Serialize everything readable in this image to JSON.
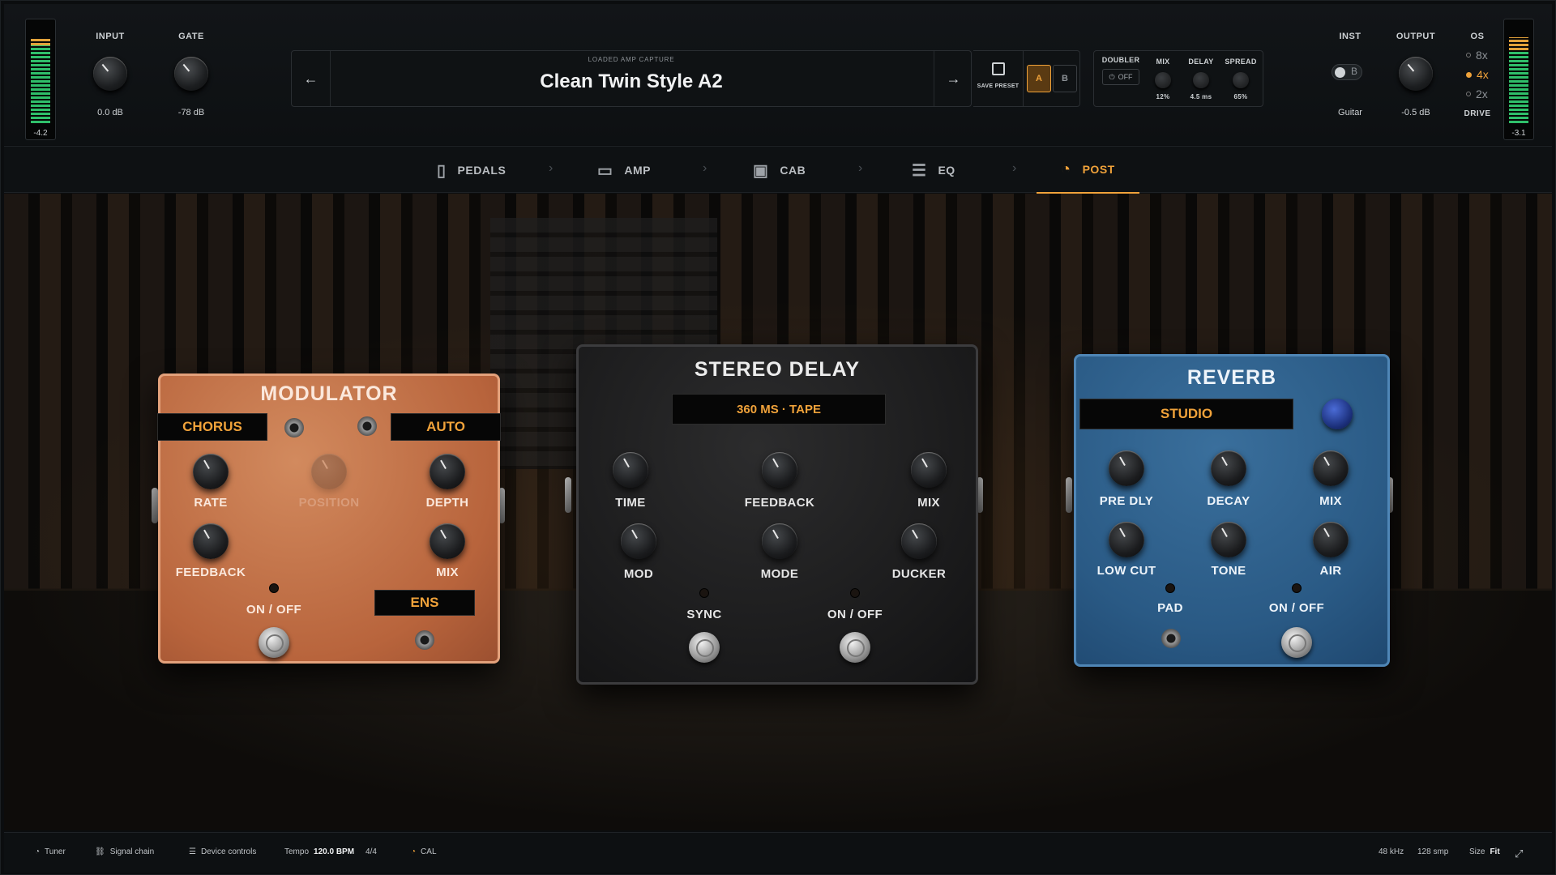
{
  "header": {
    "input_meter": {
      "value": "-4.2",
      "level": 0.82
    },
    "output_meter": {
      "value": "-3.1",
      "level": 0.78
    },
    "input": {
      "label": "INPUT",
      "value": "0.0 dB"
    },
    "gate": {
      "label": "GATE",
      "value": "-78 dB"
    },
    "preset": {
      "caption": "LOADED AMP CAPTURE",
      "name": "Clean Twin Style A2",
      "save_label": "SAVE PRESET",
      "slot_a": "A",
      "slot_b": "B",
      "active_slot": "A"
    },
    "doubler": {
      "label": "DOUBLER",
      "power": "OFF",
      "mix_label": "MIX",
      "mix_value": "12%",
      "delay_label": "DELAY",
      "delay_value": "4.5 ms",
      "spread_label": "SPREAD",
      "spread_value": "65%"
    },
    "inst": {
      "label": "INST",
      "toggle": "B",
      "value": "Guitar"
    },
    "output": {
      "label": "OUTPUT",
      "value": "-0.5 dB"
    },
    "os": {
      "label": "OS",
      "options": [
        "8x",
        "4x",
        "2x"
      ],
      "selected": "4x",
      "drive": "DRIVE"
    }
  },
  "tabs": [
    {
      "label": "PEDALS",
      "icon": "pedal-icon"
    },
    {
      "label": "AMP",
      "icon": "amp-icon"
    },
    {
      "label": "CAB",
      "icon": "cab-icon"
    },
    {
      "label": "EQ",
      "icon": "eq-sliders-icon"
    },
    {
      "label": "POST",
      "icon": "gauge-icon",
      "active": true
    }
  ],
  "modulator": {
    "title": "MODULATOR",
    "mode": "CHORUS",
    "sync": "AUTO",
    "knobs": {
      "rate": "RATE",
      "position": "POSITION",
      "depth": "DEPTH",
      "feedback": "FEEDBACK",
      "mix": "MIX"
    },
    "onoff": "ON / OFF",
    "ens": "ENS",
    "color": "#c8754a"
  },
  "delay": {
    "title": "STEREO DELAY",
    "display": "360 MS · TAPE",
    "knobs": {
      "time": "TIME",
      "feedback": "FEEDBACK",
      "mix": "MIX",
      "mod": "MOD",
      "mode": "MODE",
      "ducker": "DUCKER"
    },
    "sync": "SYNC",
    "onoff": "ON / OFF",
    "color": "#1f1f20"
  },
  "reverb": {
    "title": "REVERB",
    "display": "STUDIO",
    "knobs": {
      "predly": "PRE DLY",
      "decay": "DECAY",
      "mix": "MIX",
      "lowcut": "LOW CUT",
      "tone": "TONE",
      "air": "AIR"
    },
    "pad": "PAD",
    "onoff": "ON / OFF",
    "color": "#2a5a85"
  },
  "footer": {
    "tuner": "Tuner",
    "signal_chain": "Signal chain",
    "device_controls": "Device controls",
    "tempo_label": "Tempo",
    "tempo_value": "120.0 BPM",
    "meter": "4/4",
    "cal": "CAL",
    "sample_rate": "48 kHz",
    "buffer": "128 smp",
    "size_label": "Size",
    "size_value": "Fit"
  },
  "accent": "#f0a23a"
}
